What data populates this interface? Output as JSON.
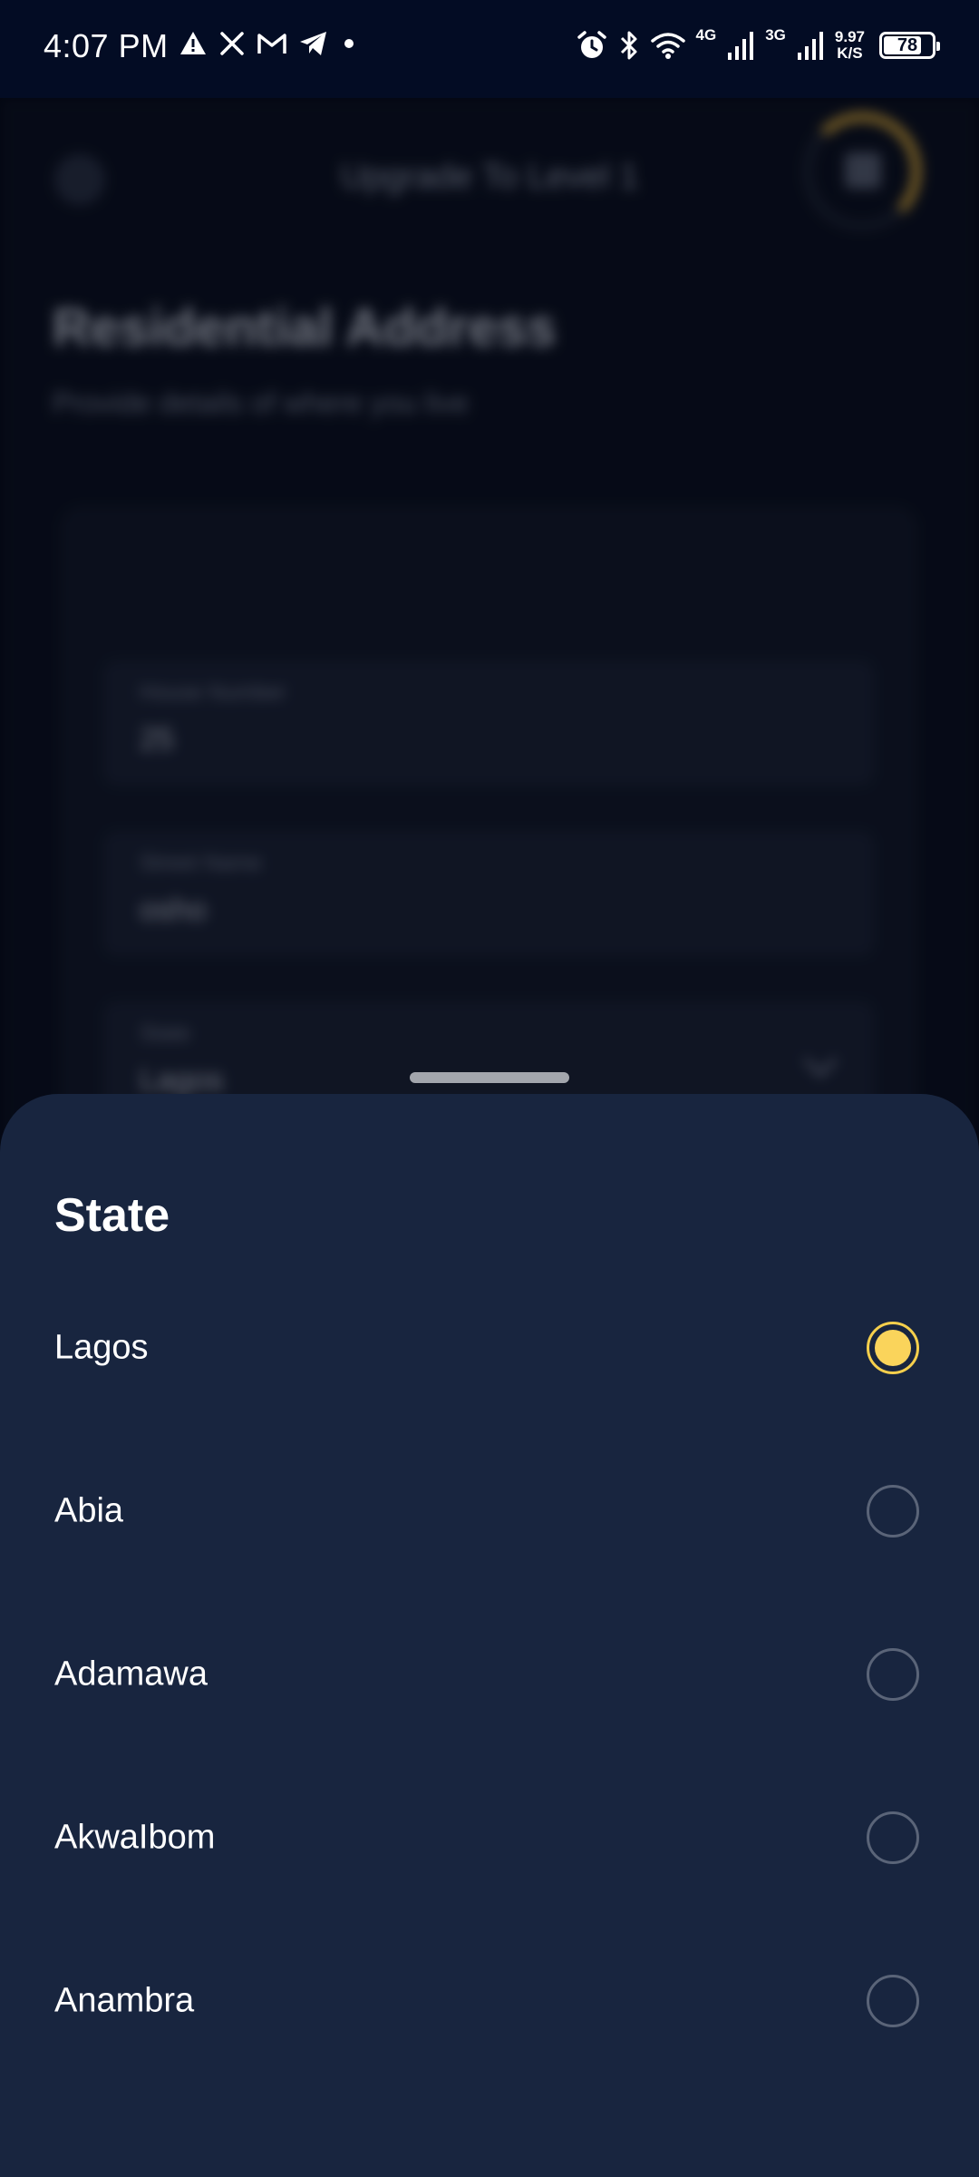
{
  "status_bar": {
    "time": "4:07 PM",
    "left_icons": [
      "warning-icon",
      "x-icon",
      "gmail-icon",
      "telegram-icon",
      "dot-icon"
    ],
    "right_icons": [
      "alarm-icon",
      "bluetooth-icon",
      "wifi-icon",
      "signal-icon"
    ],
    "network_1": "4G",
    "network_2": "3G",
    "speed_value": "9.97",
    "speed_unit": "K/S",
    "battery_level": "78",
    "battery_fraction": 0.78
  },
  "background_page": {
    "title": "Upgrade To Level 1",
    "heading": "Residential Address",
    "subheading": "Provide details of where you live",
    "fields": [
      {
        "label": "House Number",
        "value": "25"
      },
      {
        "label": "Street Name",
        "value": "osho"
      },
      {
        "label": "State",
        "value": "Lagos"
      }
    ]
  },
  "sheet": {
    "title": "State",
    "options": [
      {
        "label": "Lagos",
        "selected": true
      },
      {
        "label": "Abia",
        "selected": false
      },
      {
        "label": "Adamawa",
        "selected": false
      },
      {
        "label": "AkwaIbom",
        "selected": false
      },
      {
        "label": "Anambra",
        "selected": false
      }
    ]
  },
  "colors": {
    "sheet_background": "#18253f",
    "status_bar_background": "#030c24",
    "accent_yellow": "#fad45b",
    "text_primary": "#ffffff"
  }
}
